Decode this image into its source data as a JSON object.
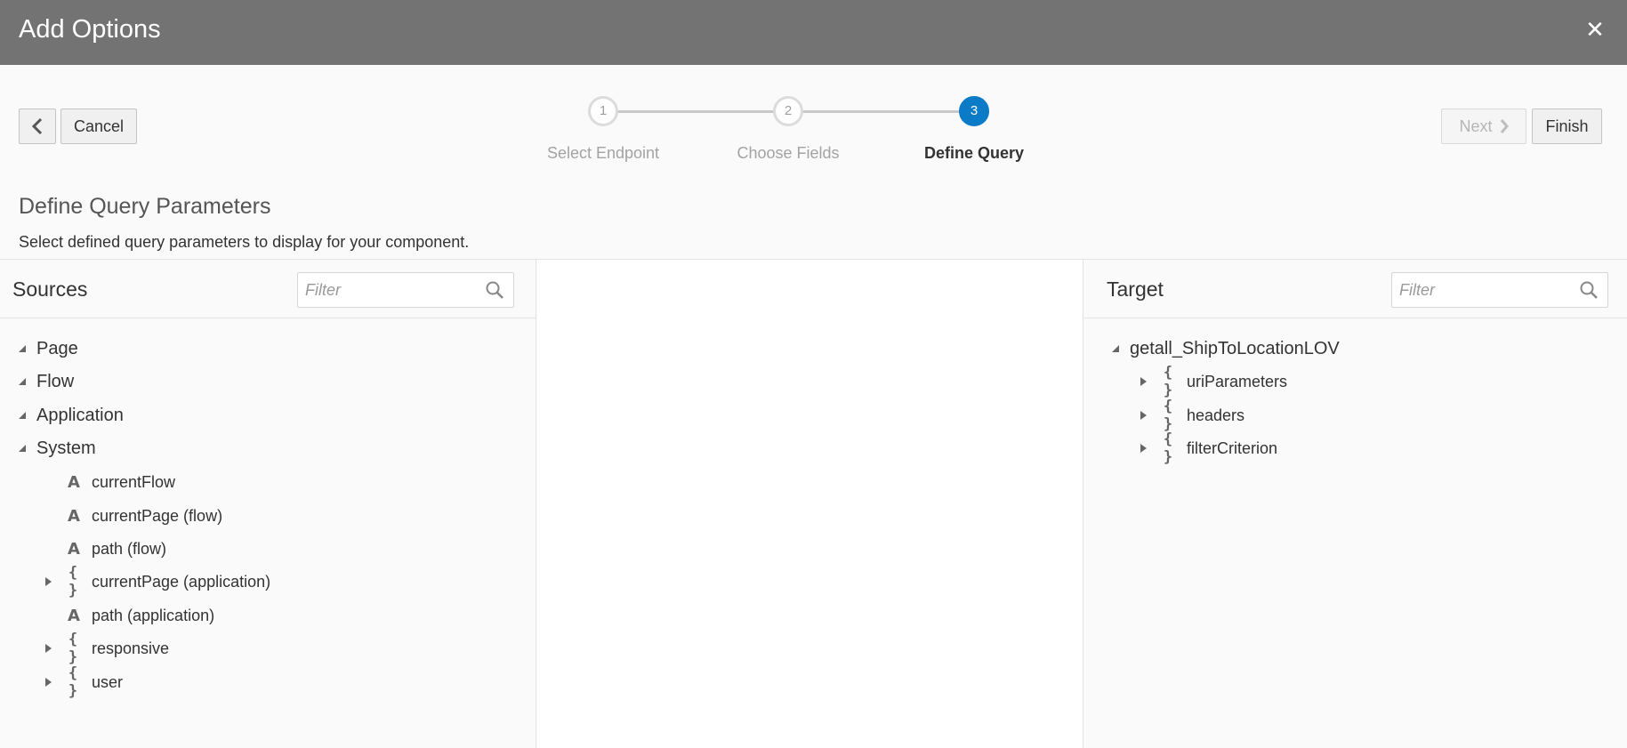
{
  "dialog": {
    "title": "Add Options"
  },
  "toolbar": {
    "cancel_label": "Cancel",
    "next_label": "Next",
    "finish_label": "Finish"
  },
  "steps": [
    {
      "number": "1",
      "label": "Select Endpoint"
    },
    {
      "number": "2",
      "label": "Choose Fields"
    },
    {
      "number": "3",
      "label": "Define Query"
    }
  ],
  "section": {
    "title": "Define Query Parameters",
    "description": "Select defined query parameters to display for your component."
  },
  "sources": {
    "title": "Sources",
    "filter_placeholder": "Filter",
    "items": [
      {
        "label": "Page",
        "icon": "triangle-expanded-icon"
      },
      {
        "label": "Flow",
        "icon": "triangle-expanded-icon"
      },
      {
        "label": "Application",
        "icon": "triangle-expanded-icon"
      },
      {
        "label": "System",
        "icon": "triangle-expanded-icon"
      },
      {
        "label": "currentFlow",
        "type_icon": "A"
      },
      {
        "label": "currentPage (flow)",
        "type_icon": "A"
      },
      {
        "label": "path (flow)",
        "type_icon": "A"
      },
      {
        "label": "currentPage (application)",
        "type_icon": "{ }"
      },
      {
        "label": "path (application)",
        "type_icon": "A"
      },
      {
        "label": "responsive",
        "type_icon": "{ }"
      },
      {
        "label": "user",
        "type_icon": "{ }"
      }
    ]
  },
  "target": {
    "title": "Target",
    "filter_placeholder": "Filter",
    "root": "getall_ShipToLocationLOV",
    "items": [
      {
        "label": "uriParameters",
        "type_icon": "{ }"
      },
      {
        "label": "headers",
        "type_icon": "{ }"
      },
      {
        "label": "filterCriterion",
        "type_icon": "{ }"
      }
    ]
  },
  "colors": {
    "titlebar": "#737373",
    "accent": "#0b7ac7"
  }
}
